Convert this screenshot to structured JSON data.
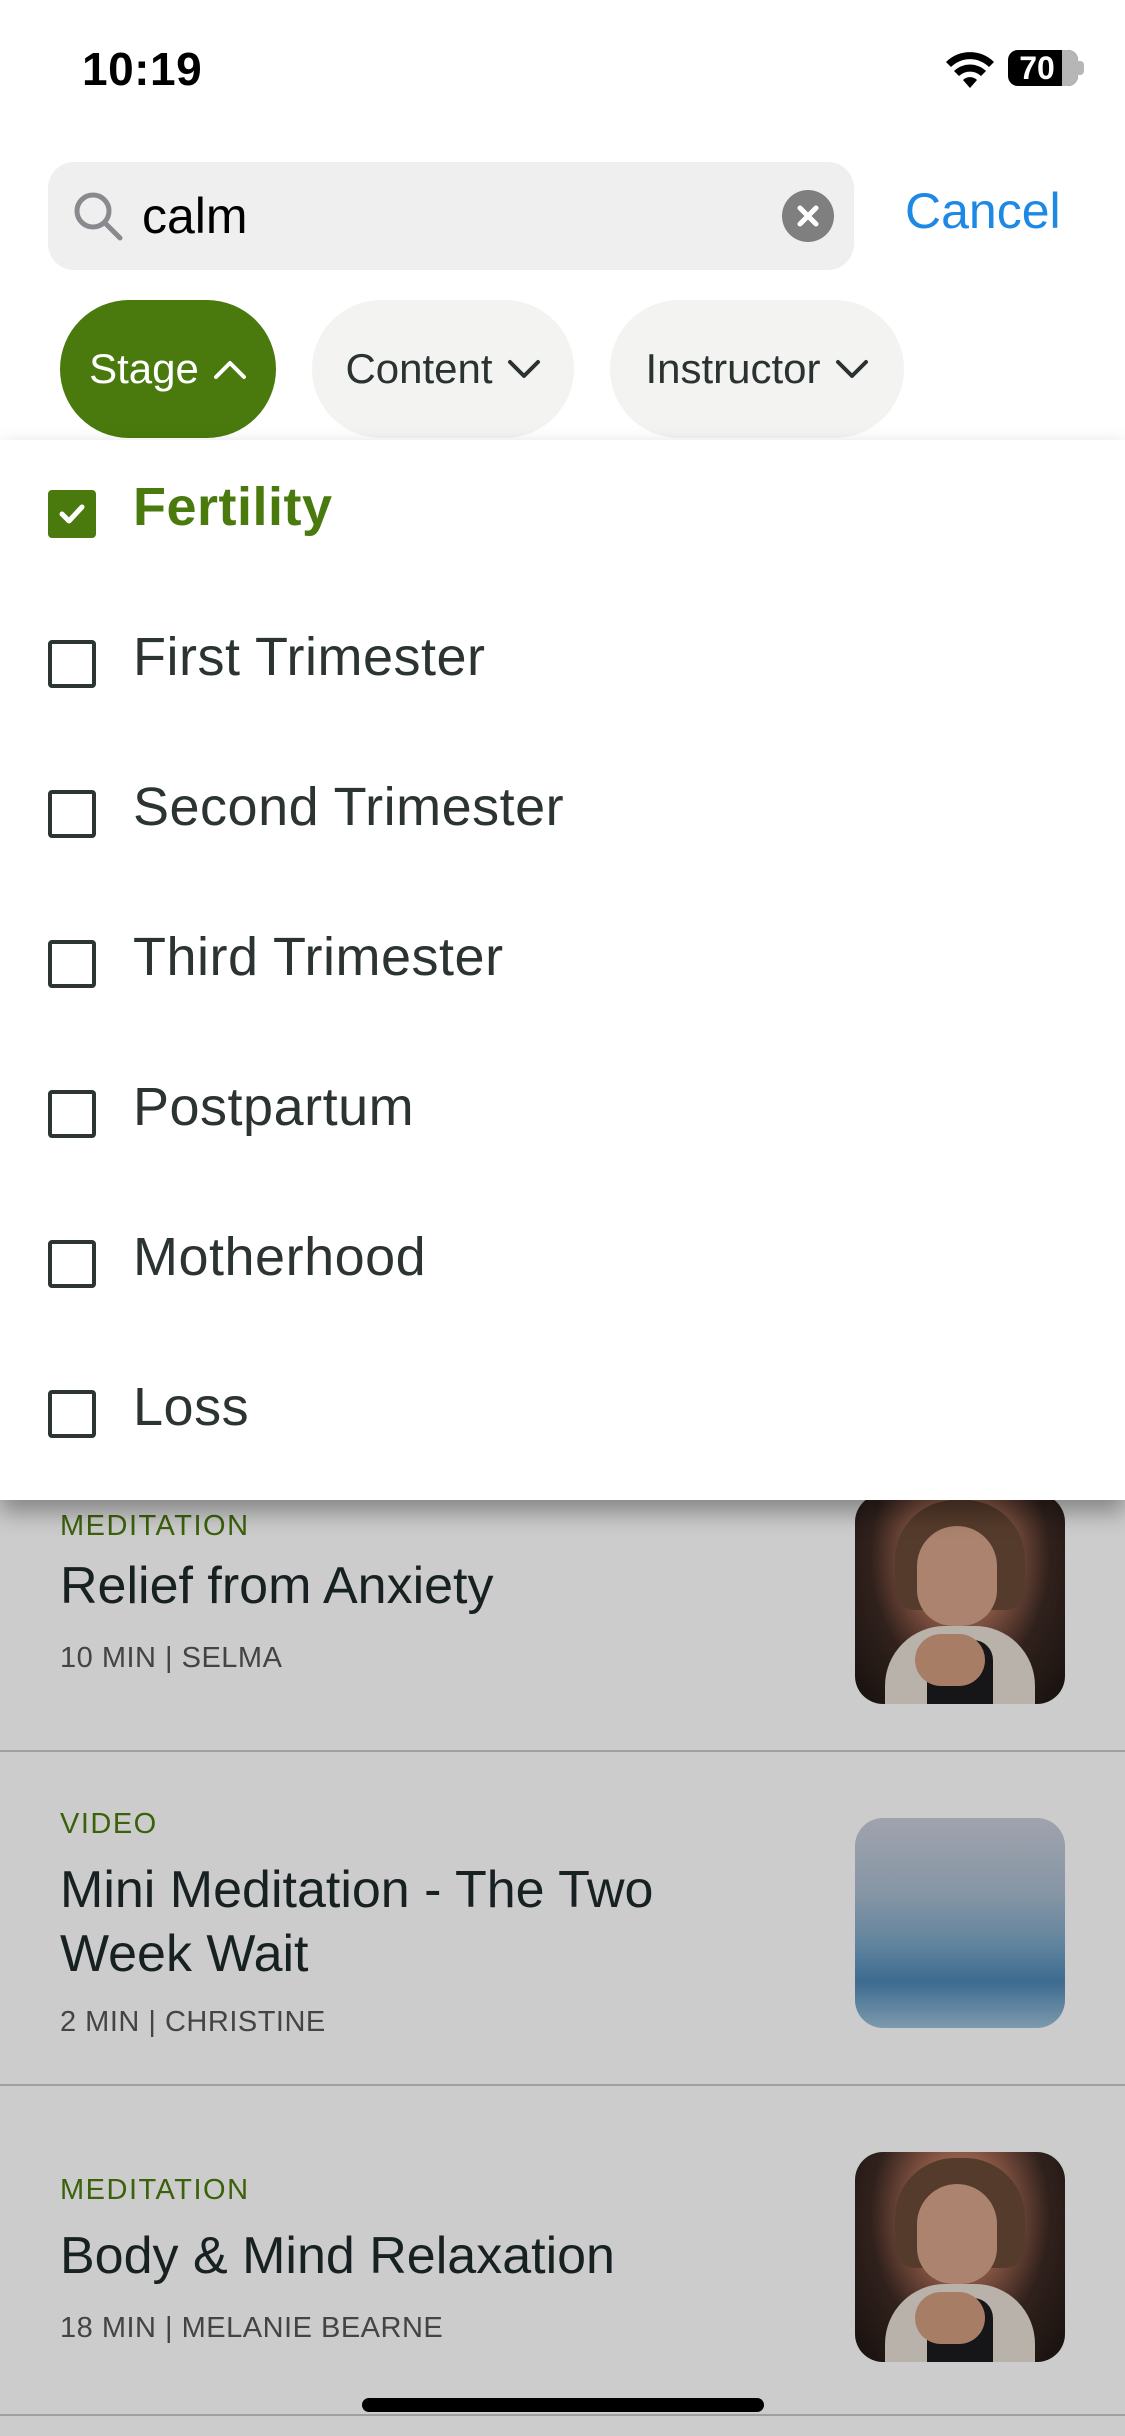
{
  "status_bar": {
    "time": "10:19",
    "battery": "70"
  },
  "search": {
    "value": "calm",
    "placeholder": "",
    "cancel_label": "Cancel"
  },
  "filters": [
    {
      "label": "Stage",
      "active": true
    },
    {
      "label": "Content",
      "active": false
    },
    {
      "label": "Instructor",
      "active": false
    }
  ],
  "stage_options": [
    {
      "label": "Fertility",
      "checked": true
    },
    {
      "label": "First Trimester",
      "checked": false
    },
    {
      "label": "Second Trimester",
      "checked": false
    },
    {
      "label": "Third Trimester",
      "checked": false
    },
    {
      "label": "Postpartum",
      "checked": false
    },
    {
      "label": "Motherhood",
      "checked": false
    },
    {
      "label": "Loss",
      "checked": false
    }
  ],
  "results": [
    {
      "type": "MEDITATION",
      "title": "Relief from Anxiety",
      "meta": "10 MIN | SELMA",
      "thumbnail": "woman-meditating"
    },
    {
      "type": "VIDEO",
      "title": "Mini Meditation - The Two Week Wait",
      "meta": "2 MIN | CHRISTINE",
      "thumbnail": "misty-mountains"
    },
    {
      "type": "MEDITATION",
      "title": "Body & Mind Relaxation",
      "meta": "18 MIN | MELANIE BEARNE",
      "thumbnail": "woman-meditating"
    }
  ],
  "colors": {
    "accent_green": "#4a7a0e",
    "link_blue": "#1e88e5",
    "chip_bg": "#f3f3f1"
  }
}
